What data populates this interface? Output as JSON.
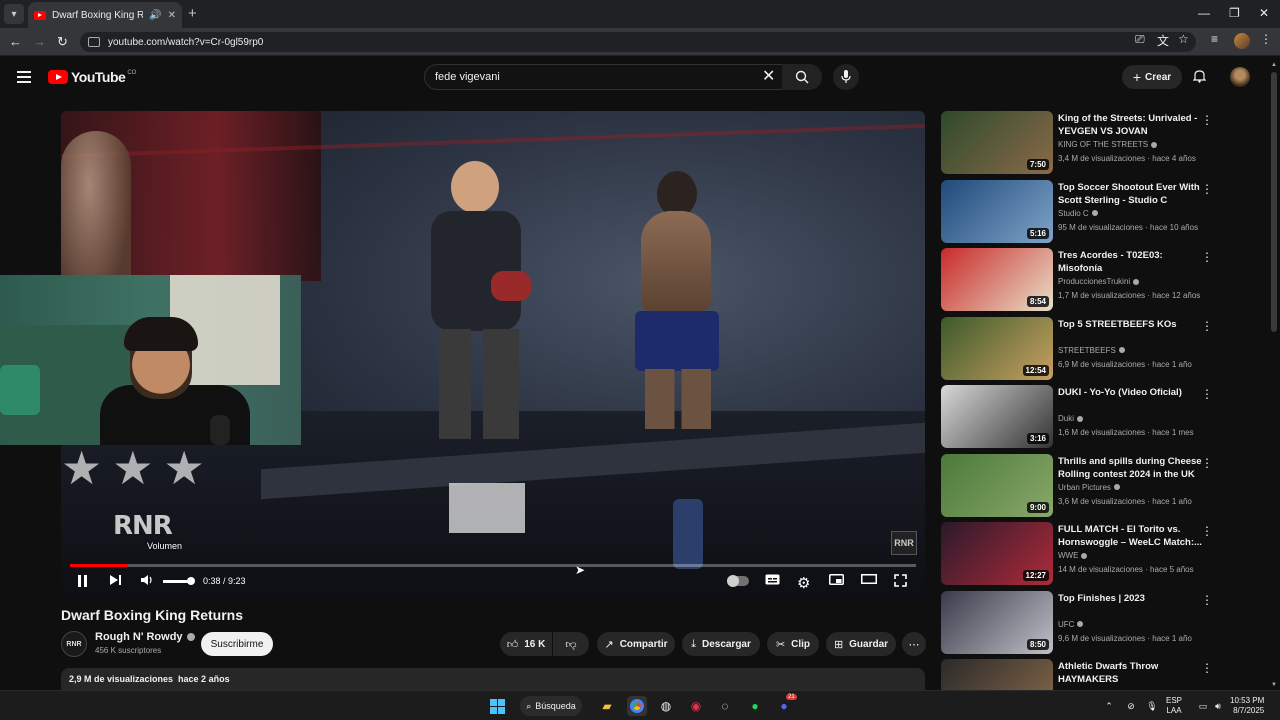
{
  "browser": {
    "tab_title": "Dwarf Boxing King Returns",
    "url": "youtube.com/watch?v=Cr-0gl59rp0"
  },
  "header": {
    "logo_text": "YouTube",
    "country_code": "CO",
    "search_value": "fede vigevani",
    "create_label": "Crear"
  },
  "player": {
    "tooltip": "Volumen",
    "time": "0:38 / 9:23",
    "watermark": "RNR",
    "corner_logo": "RNR",
    "progress_fraction": 0.068
  },
  "video": {
    "title": "Dwarf Boxing King Returns",
    "channel": "Rough N' Rowdy",
    "channel_avatar_text": "RNR",
    "subscribers": "456 K suscriptores",
    "subscribe_label": "Suscribirme",
    "likes": "16 K",
    "share_label": "Compartir",
    "download_label": "Descargar",
    "clip_label": "Clip",
    "save_label": "Guardar",
    "views_age": "2,9 M de visualizaciones  hace 2 años"
  },
  "recommendations": [
    {
      "title": "King of the Streets: Unrivaled - YEVGEN VS JOVAN",
      "channel": "KING OF THE STREETS",
      "meta": "3,4 M de visualizaciones · hace 4 años",
      "duration": "7:50",
      "colors": [
        "#2e4a2a",
        "#8a6a4a"
      ]
    },
    {
      "title": "Top Soccer Shootout Ever With Scott Sterling - Studio C",
      "channel": "Studio C",
      "meta": "95 M de visualizaciones · hace 10 años",
      "duration": "5:16",
      "colors": [
        "#1f4a7a",
        "#7fa3c8"
      ]
    },
    {
      "title": "Tres Acordes -  T02E03: Misofonía",
      "channel": "ProduccionesTrukini",
      "meta": "1,7 M de visualizaciones · hace 12 años",
      "duration": "8:54",
      "colors": [
        "#c92a2a",
        "#e8e0c8"
      ]
    },
    {
      "title": "Top 5 STREETBEEFS KOs",
      "channel": "STREETBEEFS",
      "meta": "6,9 M de visualizaciones · hace 1 año",
      "duration": "12:54",
      "colors": [
        "#3c5a2a",
        "#c8a060"
      ]
    },
    {
      "title": "DUKI - Yo-Yo (Video Oficial)",
      "channel": "Duki",
      "meta": "1,6 M de visualizaciones · hace 1 mes",
      "duration": "3:16",
      "colors": [
        "#d8d8d8",
        "#333333"
      ]
    },
    {
      "title": "Thrills and spills during Cheese Rolling contest 2024 in the UK",
      "channel": "Urban Pictures",
      "meta": "3,6 M de visualizaciones · hace 1 año",
      "duration": "9:00",
      "colors": [
        "#4a7a3a",
        "#8aa86a"
      ]
    },
    {
      "title": "FULL MATCH - El Torito vs. Hornswoggle – WeeLC Match:...",
      "channel": "WWE",
      "meta": "14 M de visualizaciones · hace 5 años",
      "duration": "12:27",
      "colors": [
        "#2a1a2a",
        "#b02a3a"
      ]
    },
    {
      "title": "Top Finishes | 2023",
      "channel": "UFC",
      "meta": "9,6 M de visualizaciones · hace 1 año",
      "duration": "8:50",
      "colors": [
        "#3a3a4a",
        "#c0c0c8"
      ]
    },
    {
      "title": "Athletic Dwarfs Throw HAYMAKERS",
      "channel": "",
      "meta": "",
      "duration": "",
      "colors": [
        "#2a2a2a",
        "#8a6a4a"
      ]
    }
  ],
  "taskbar": {
    "search_label": "Búsqueda",
    "lang_top": "ESP",
    "lang_bottom": "LAA",
    "time": "10:53 PM",
    "date": "8/7/2025",
    "discord_badge": "21"
  }
}
